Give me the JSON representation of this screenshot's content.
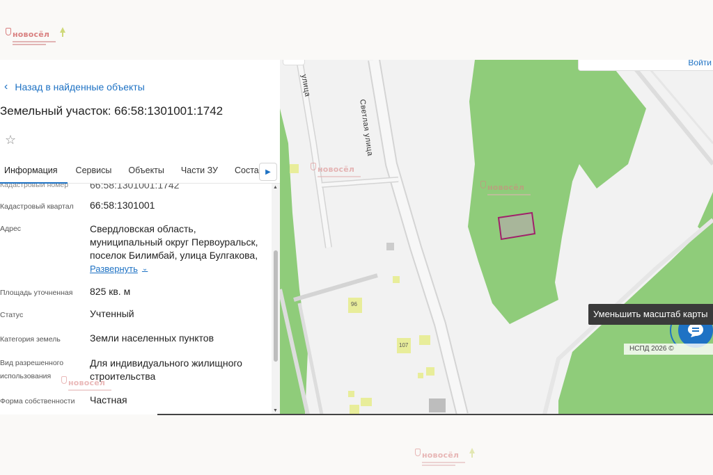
{
  "watermark": {
    "brand": "новосёл"
  },
  "panel": {
    "back_link": "Назад в найденные объекты",
    "title": "Земельный участок: 66:58:1301001:1742",
    "tabs": [
      "Информация",
      "Сервисы",
      "Объекты",
      "Части ЗУ",
      "Состав"
    ],
    "active_tab": "Информация",
    "details": {
      "partial_label": "Кадастровый номер",
      "partial_value": "66:58:1301001:1742",
      "quarter_label": "Кадастровый квартал",
      "quarter_value": "66:58:1301001",
      "address_label": "Адрес",
      "address_line1": "Свердловская область,",
      "address_line2": "муниципальный округ Первоуральск,",
      "address_line3": "поселок Билимбай, улица Булгакова,",
      "expand_label": "Развернуть",
      "area_label": "Площадь уточненная",
      "area_value": "825 кв. м",
      "status_label": "Статус",
      "status_value": "Учтенный",
      "category_label": "Категория земель",
      "category_value": "Земли населенных пунктов",
      "use_label_line1": "Вид разрешенного",
      "use_label_line2": "использования",
      "use_value_line1": "Для индивидуального жилищного",
      "use_value_line2": "строительства",
      "ownership_label": "Форма собственности",
      "ownership_value": "Частная"
    }
  },
  "map": {
    "street_labels": {
      "svetlaya": "Светлая улица",
      "partial": "улица"
    },
    "building_numbers": {
      "b96": "96",
      "b107": "107"
    },
    "top_control_text": "Войти",
    "tooltip": "Уменьшить масштаб карты",
    "attribution": "НСПД 2026 ©",
    "colors": {
      "forest": "#8fcc7a",
      "parcel_stroke": "#a0206a",
      "parcel_fill": "#a8b69a",
      "road": "#dcdcdc",
      "background": "#f2f2f2"
    }
  }
}
